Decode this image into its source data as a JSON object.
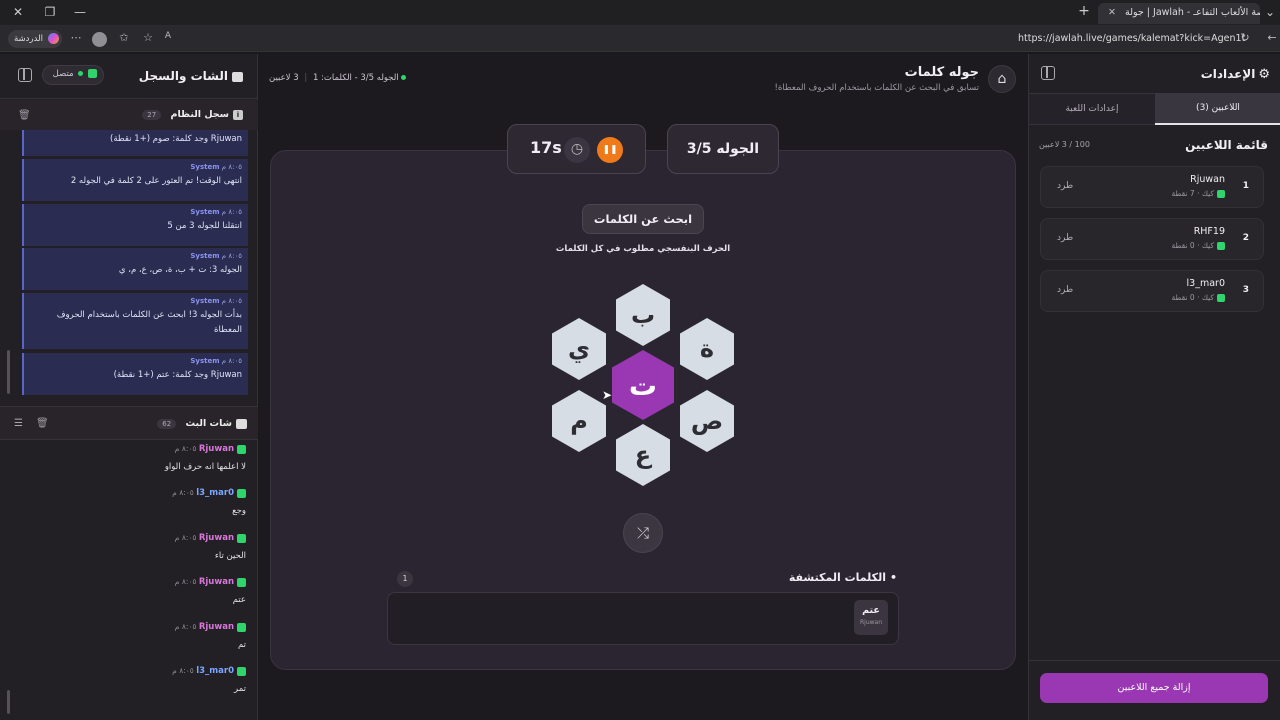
{
  "browser": {
    "tab_title": "جولة | Jawlah - منصة الألعاب التفاعـ",
    "tab_favicon": "جولة",
    "url": "https://jawlah.live/games/kalemat?kick=Agen1t",
    "sidebar_label": "الدردشة"
  },
  "chat_panel": {
    "title": "الشات والسجل",
    "status": "متصل",
    "system_log": {
      "title": "سجل النظام",
      "count": "27",
      "partial_top": "Rjuwan وجد كلمة: صوم (+1 نقطة)",
      "messages": [
        {
          "who": "System",
          "time": "٨:٠٥ م",
          "text": "انتهى الوقت! تم العثور على 2 كلمة في الجوله 2"
        },
        {
          "who": "System",
          "time": "٨:٠٥ م",
          "text": "انتقلنا للجوله 3 من 5"
        },
        {
          "who": "System",
          "time": "٨:٠٥ م",
          "text": "الجوله 3: ت + ب، ة، ص، ع، م، ي"
        },
        {
          "who": "System",
          "time": "٨:٠٥ م",
          "text": "بدأت الجوله 3! ابحث عن الكلمات باستخدام الحروف المعطاة"
        },
        {
          "who": "System",
          "time": "٨:٠٥ م",
          "text": "Rjuwan وجد كلمة: عتم (+1 نقطة)"
        }
      ]
    },
    "stream_chat": {
      "title": "شات البث",
      "count": "62",
      "messages": [
        {
          "who": "Rjuwan",
          "time": "٨:٠٥ م",
          "text": "لا اعلمها انه حرف الواو"
        },
        {
          "who": "l3_mar0",
          "time": "٨:٠٥ م",
          "text": "وجع"
        },
        {
          "who": "Rjuwan",
          "time": "٨:٠٥ م",
          "text": "الحين تاء"
        },
        {
          "who": "Rjuwan",
          "time": "٨:٠٥ م",
          "text": "عتم"
        },
        {
          "who": "Rjuwan",
          "time": "٨:٠٥ م",
          "text": "تم"
        },
        {
          "who": "l3_mar0",
          "time": "٨:٠٥ م",
          "text": "تمر"
        }
      ]
    }
  },
  "game": {
    "title": "جوله كلمات",
    "subtitle": "تسابق في البحث عن الكلمات باستخدام الحروف المعطاة!",
    "status_players": "3 لاعبين",
    "status_round": "الجوله 3/5 - الكلمات: 1",
    "round_label": "الجوله 3/5",
    "timer": "17s",
    "find_words": "ابحث عن الكلمات",
    "hint": "الحرف البنفسجي مطلوب في كل الكلمات",
    "center_letter": "ت",
    "letters": {
      "top": "ب",
      "top_right": "ة",
      "bottom_right": "ص",
      "bottom": "ع",
      "bottom_left": "م",
      "top_left": "ي"
    },
    "found_title": "الكلمات المكتشفة",
    "found_count": "1",
    "found_words": [
      {
        "word": "عتم",
        "by": "Rjuwan"
      }
    ]
  },
  "settings": {
    "title": "الإعدادات",
    "tab_players": "اللاعبين (3)",
    "tab_game": "إعدادات اللعبة",
    "list_title": "قائمة اللاعبين",
    "capacity": "100 / 3 لاعبين",
    "players": [
      {
        "rank": "1",
        "name": "Rjuwan",
        "platform": "كيك",
        "points": "7 نقطة",
        "kick": "طرد"
      },
      {
        "rank": "2",
        "name": "RHF19",
        "platform": "كيك",
        "points": "0 نقطة",
        "kick": "طرد"
      },
      {
        "rank": "3",
        "name": "l3_mar0",
        "platform": "كيك",
        "points": "0 نقطة",
        "kick": "طرد"
      }
    ],
    "remove_all": "إزالة جميع اللاعبين"
  },
  "colors": {
    "accent_purple": "#9a37b3",
    "kick_green": "#2fd46a",
    "system_blue": "#2a2c52"
  }
}
